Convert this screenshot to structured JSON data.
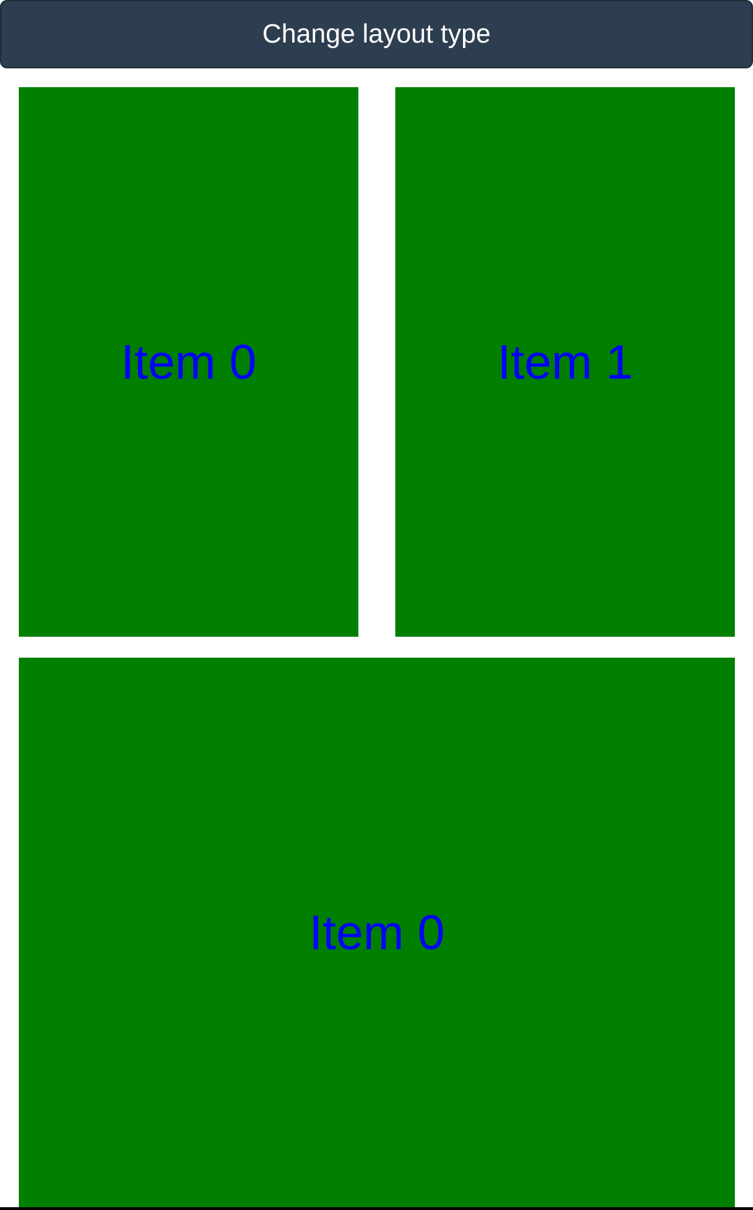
{
  "header": {
    "button_label": "Change layout type"
  },
  "items": [
    {
      "label": "Item 0"
    },
    {
      "label": "Item 1"
    },
    {
      "label": "Item 0"
    }
  ],
  "colors": {
    "header_bg": "#2d3e50",
    "item_bg": "#007f00",
    "item_text": "#0000ff",
    "page_bg": "#ffffff"
  }
}
